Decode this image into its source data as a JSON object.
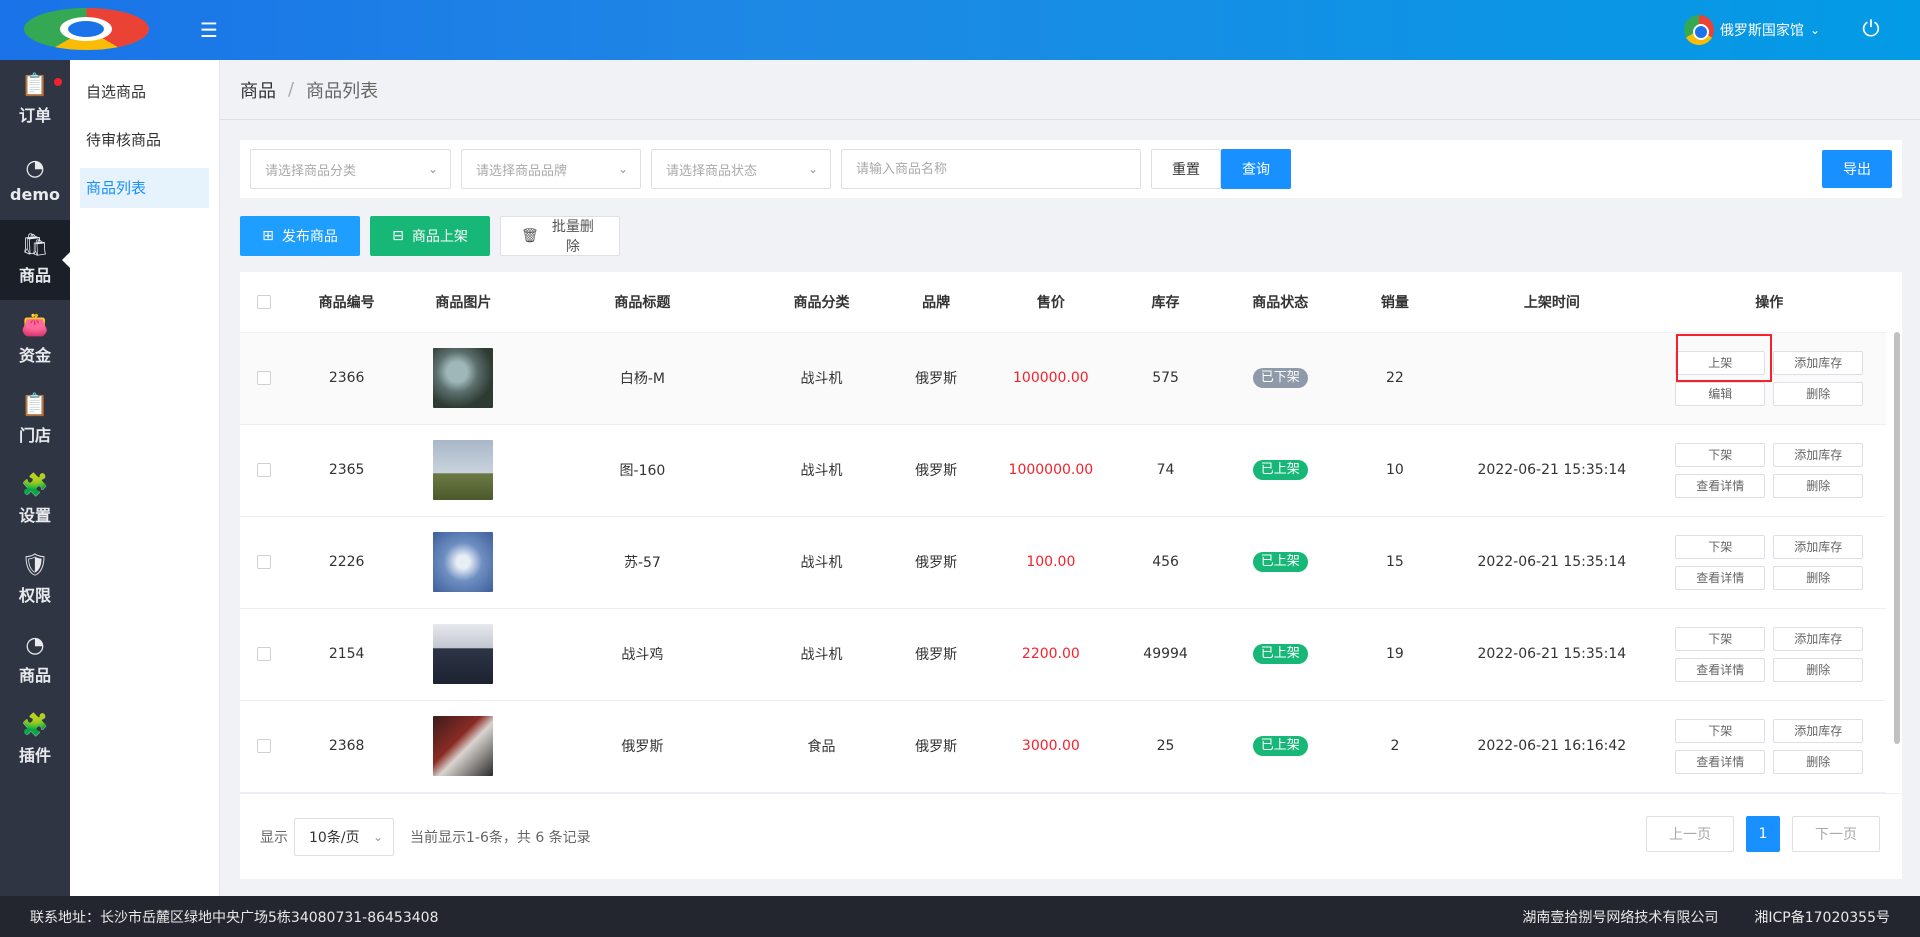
{
  "header": {
    "user_name": "俄罗斯国家馆",
    "icons": {
      "menu": "hamburger-menu-icon",
      "power": "power-icon"
    }
  },
  "nav": {
    "items": [
      {
        "label": "订单",
        "icon": "order-clipboard-icon"
      },
      {
        "label": "demo",
        "icon": "pie-chart-icon"
      },
      {
        "label": "商品",
        "icon": "shopping-bag-icon"
      },
      {
        "label": "资金",
        "icon": "wallet-icon"
      },
      {
        "label": "门店",
        "icon": "clipboard-icon"
      },
      {
        "label": "设置",
        "icon": "puzzle-icon"
      },
      {
        "label": "权限",
        "icon": "shield-icon"
      },
      {
        "label": "商品",
        "icon": "pie-chart-icon"
      },
      {
        "label": "插件",
        "icon": "puzzle-icon"
      }
    ]
  },
  "subnav": {
    "items": [
      "自选商品",
      "待审核商品",
      "商品列表"
    ]
  },
  "breadcrumb": {
    "parent": "商品",
    "separator": "/",
    "current": "商品列表"
  },
  "filter": {
    "category_placeholder": "请选择商品分类",
    "brand_placeholder": "请选择商品品牌",
    "status_placeholder": "请选择商品状态",
    "name_placeholder": "请输入商品名称",
    "reset_label": "重置",
    "query_label": "查询",
    "export_label": "导出"
  },
  "actions": {
    "publish": "发布商品",
    "shelve": "商品上架",
    "batch_delete": "批量删除"
  },
  "table": {
    "headers": [
      "",
      "商品编号",
      "商品图片",
      "商品标题",
      "商品分类",
      "品牌",
      "售价",
      "库存",
      "商品状态",
      "销量",
      "上架时间",
      "操作"
    ],
    "rows": [
      {
        "id": "2366",
        "title": "白杨-M",
        "category": "战斗机",
        "brand": "俄罗斯",
        "price": "100000.00",
        "stock": "575",
        "status": "已下架",
        "sales": "22",
        "time": "",
        "op1": "上架",
        "op2": "添加库存",
        "op3": "编辑",
        "op4": "删除"
      },
      {
        "id": "2365",
        "title": "图-160",
        "category": "战斗机",
        "brand": "俄罗斯",
        "price": "1000000.00",
        "stock": "74",
        "status": "已上架",
        "sales": "10",
        "time": "2022-06-21 15:35:14",
        "op1": "下架",
        "op2": "添加库存",
        "op3": "查看详情",
        "op4": "删除"
      },
      {
        "id": "2226",
        "title": "苏-57",
        "category": "战斗机",
        "brand": "俄罗斯",
        "price": "100.00",
        "stock": "456",
        "status": "已上架",
        "sales": "15",
        "time": "2022-06-21 15:35:14",
        "op1": "下架",
        "op2": "添加库存",
        "op3": "查看详情",
        "op4": "删除"
      },
      {
        "id": "2154",
        "title": "战斗鸡",
        "category": "战斗机",
        "brand": "俄罗斯",
        "price": "2200.00",
        "stock": "49994",
        "status": "已上架",
        "sales": "19",
        "time": "2022-06-21 15:35:14",
        "op1": "下架",
        "op2": "添加库存",
        "op3": "查看详情",
        "op4": "删除"
      },
      {
        "id": "2368",
        "title": "俄罗斯",
        "category": "食品",
        "brand": "俄罗斯",
        "price": "3000.00",
        "stock": "25",
        "status": "已上架",
        "sales": "2",
        "time": "2022-06-21 16:16:42",
        "op1": "下架",
        "op2": "添加库存",
        "op3": "查看详情",
        "op4": "删除"
      }
    ]
  },
  "pagination": {
    "show_label": "显示",
    "page_size": "10条/页",
    "summary": "当前显示1-6条，共 6 条记录",
    "prev": "上一页",
    "current_page": "1",
    "next": "下一页"
  },
  "footer": {
    "address": "联系地址：长沙市岳麓区绿地中央广场5栋34080731-86453408",
    "company": "湖南壹拾捌号网络技术有限公司",
    "icp": "湘ICP备17020355号"
  },
  "colors": {
    "primary": "#1890ff",
    "success": "#16b777",
    "danger": "#f5222d",
    "nav_bg": "#2f3542"
  }
}
